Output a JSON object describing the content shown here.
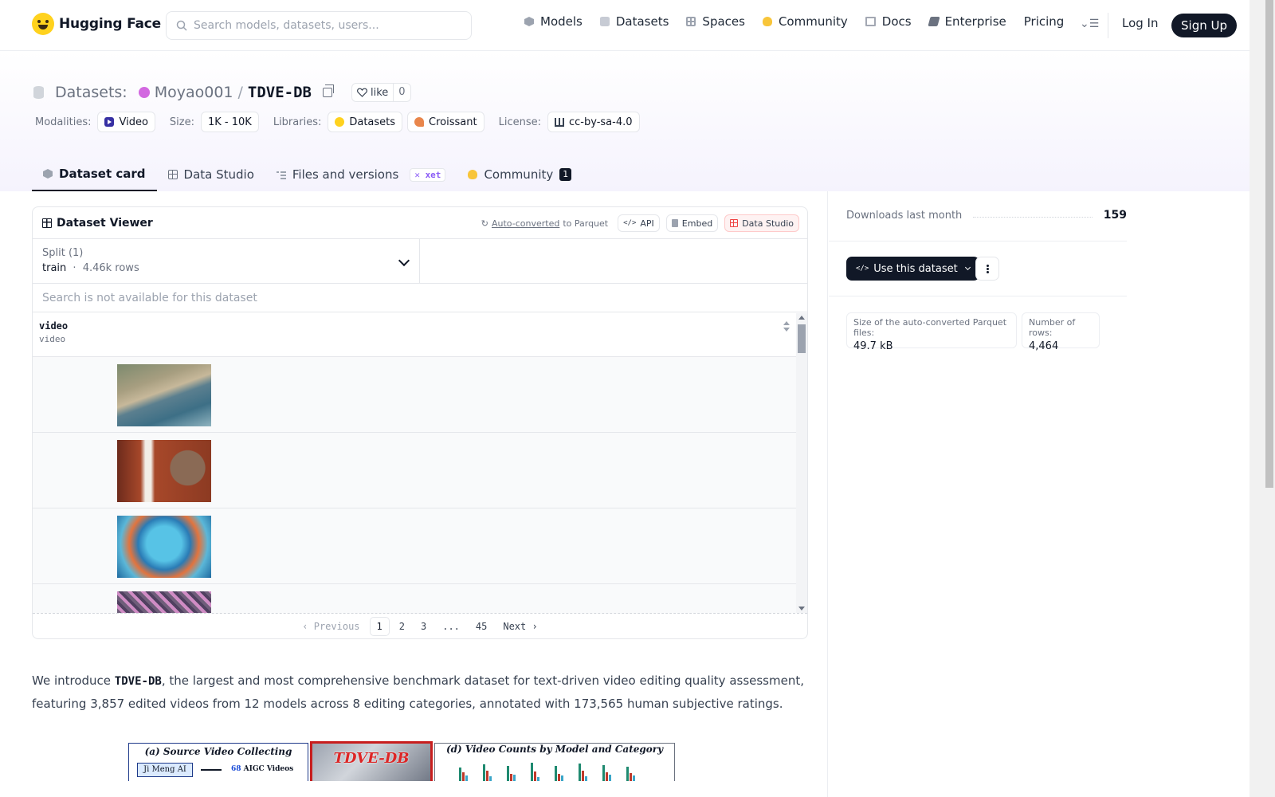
{
  "nav": {
    "brand": "Hugging Face",
    "search_placeholder": "Search models, datasets, users...",
    "links": [
      "Models",
      "Datasets",
      "Spaces",
      "Community",
      "Docs",
      "Enterprise",
      "Pricing"
    ],
    "login": "Log In",
    "signup": "Sign Up"
  },
  "repo": {
    "type_label": "Datasets:",
    "owner": "Moyao001",
    "name": "TDVE-DB",
    "like_label": "like",
    "like_count": "0"
  },
  "meta": {
    "modalities_label": "Modalities:",
    "modality": "Video",
    "size_label": "Size:",
    "size": "1K - 10K",
    "libraries_label": "Libraries:",
    "libraries": [
      "Datasets",
      "Croissant"
    ],
    "license_label": "License:",
    "license": "cc-by-sa-4.0"
  },
  "tabs": {
    "card": "Dataset card",
    "studio": "Data Studio",
    "files": "Files and versions",
    "xet": "xet",
    "community": "Community",
    "community_count": "1"
  },
  "viewer": {
    "title": "Dataset Viewer",
    "auto_converted": "Auto-converted",
    "to_parquet": "to Parquet",
    "api": "API",
    "embed": "Embed",
    "data_studio": "Data Studio",
    "split_label": "Split (1)",
    "split_name": "train",
    "split_sep": "·",
    "split_rows": "4.46k rows",
    "search_disabled": "Search is not available for this dataset",
    "column_name": "video",
    "column_type": "video",
    "pagination": {
      "previous": "Previous",
      "pages": [
        "1",
        "2",
        "3",
        "...",
        "45"
      ],
      "next": "Next",
      "current": "1"
    }
  },
  "intro": {
    "before": "We introduce ",
    "bold": "TDVE-DB",
    "after": ", the largest and most comprehensive benchmark dataset for text-driven video editing quality assessment, featuring 3,857 edited videos from 12 models across 8 editing categories, annotated with 173,565 human subjective ratings."
  },
  "figure": {
    "panel_a_title": "(a) Source Video Collecting",
    "panel_a_box": "Ji Meng AI",
    "panel_a_count": "68",
    "panel_a_text": "AIGC Videos",
    "panel_b_title": "TDVE-DB",
    "panel_c_title": "(d) Video Counts by Model and Category"
  },
  "sidebar": {
    "downloads_label": "Downloads last month",
    "downloads_value": "159",
    "use_dataset": "Use this dataset",
    "parquet_size_label": "Size of the auto-converted Parquet files:",
    "parquet_size": "49.7 kB",
    "rows_label": "Number of rows:",
    "rows_value": "4,464"
  },
  "colors": {
    "accent_dark": "#111827",
    "header_tint": "#f5f3fd",
    "avatar": "#d268e0",
    "studio_red": "#ef4444"
  }
}
